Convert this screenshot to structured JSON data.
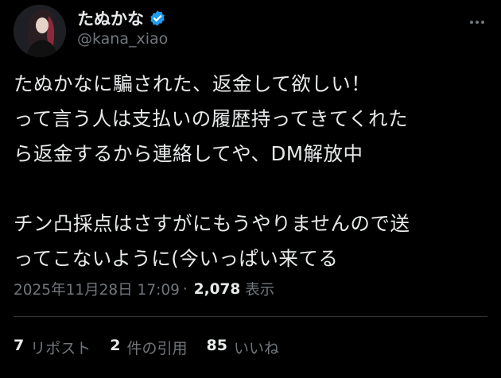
{
  "author": {
    "display_name": "たぬかな",
    "handle": "@kana_xiao"
  },
  "tweet": {
    "text": "たぬかなに騙された、返金して欲しい！\nって言う人は支払いの履歴持ってきてくれた\nら返金するから連絡してや、DM解放中\n\nチン凸採点はさすがにもうやりませんので送\nってこないように(今いっぱい来てる",
    "timestamp": "2025年11月28日 17:09",
    "separator": "·",
    "views": "2,078",
    "views_label": "表示"
  },
  "stats": {
    "reposts": {
      "count": "7",
      "label": "リポスト"
    },
    "quotes": {
      "count": "2",
      "label": "件の引用"
    },
    "likes": {
      "count": "85",
      "label": "いいね"
    }
  },
  "colors": {
    "background": "#000000",
    "text_primary": "#e7e9ea",
    "text_secondary": "#71767b",
    "verified_badge": "#1d9bf0",
    "divider": "#2f3336"
  },
  "icons": {
    "verified": "verified-badge-icon",
    "more": "more-options-icon"
  }
}
